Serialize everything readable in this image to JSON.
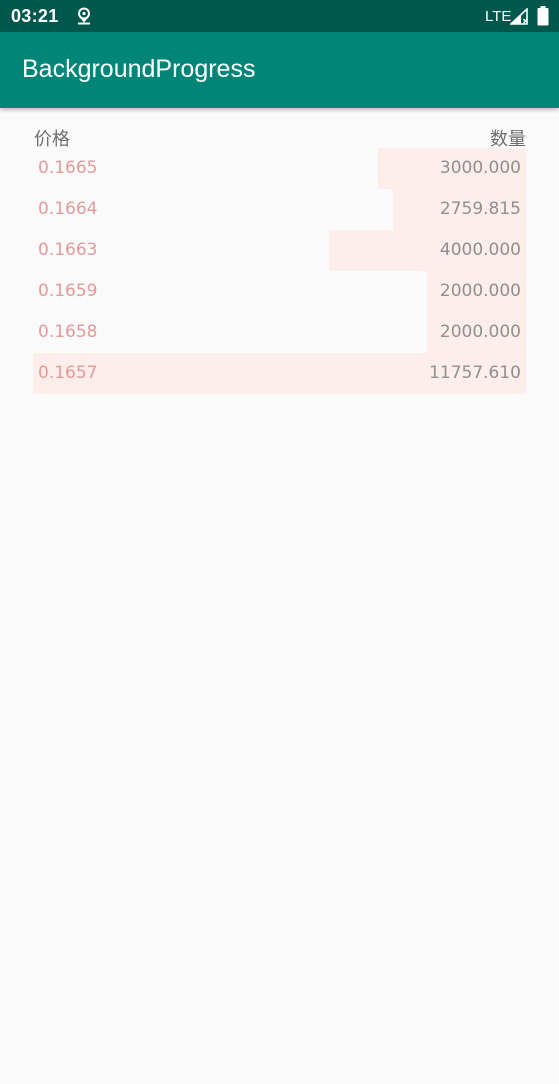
{
  "status_bar": {
    "time": "03:21",
    "network": "LTE",
    "icons": [
      "location-icon",
      "signal-icon",
      "battery-icon"
    ]
  },
  "app_bar": {
    "title": "BackgroundProgress"
  },
  "order_book": {
    "header": {
      "price_label": "价格",
      "quantity_label": "数量"
    },
    "rows": [
      {
        "price": "0.1665",
        "quantity": "3000.000",
        "depth_fraction": 0.3
      },
      {
        "price": "0.1664",
        "quantity": "2759.815",
        "depth_fraction": 0.27
      },
      {
        "price": "0.1663",
        "quantity": "4000.000",
        "depth_fraction": 0.4
      },
      {
        "price": "0.1659",
        "quantity": "2000.000",
        "depth_fraction": 0.2
      },
      {
        "price": "0.1658",
        "quantity": "2000.000",
        "depth_fraction": 0.2
      },
      {
        "price": "0.1657",
        "quantity": "11757.610",
        "depth_fraction": 1.0
      }
    ]
  },
  "colors": {
    "status_bar": "#00574b",
    "app_bar": "#008577",
    "background": "#fafafa",
    "depth_bar": "#fdeeeb",
    "price_text": "#e29a9a",
    "quantity_text": "#8f8f8f",
    "header_text": "#6e6e6e"
  }
}
